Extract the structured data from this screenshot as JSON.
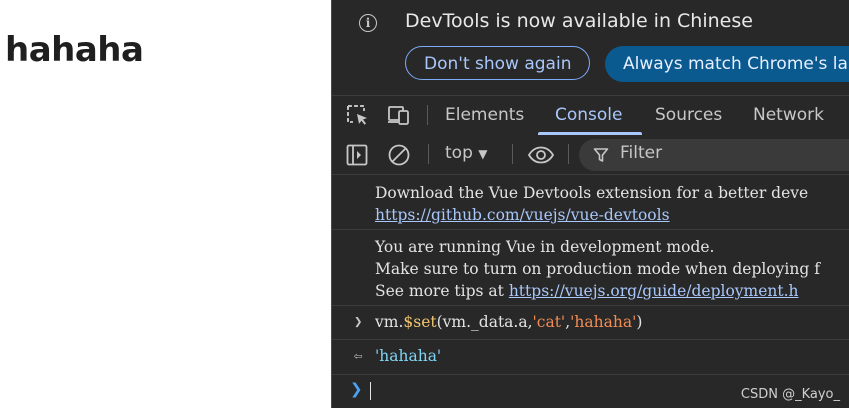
{
  "page": {
    "heading": "hahaha"
  },
  "devtools": {
    "infobar": {
      "message": "DevTools is now available in Chinese",
      "dont_show_label": "Don't show again",
      "always_match_label": "Always match Chrome's lar"
    },
    "tabs": [
      {
        "label": "Elements",
        "active": false
      },
      {
        "label": "Console",
        "active": true
      },
      {
        "label": "Sources",
        "active": false
      },
      {
        "label": "Network",
        "active": false
      }
    ],
    "console_toolbar": {
      "context": "top",
      "filter_placeholder": "Filter"
    },
    "messages": [
      {
        "lines": [
          {
            "text": "Download the Vue Devtools extension for a better deve",
            "link": ""
          },
          {
            "text": "",
            "link": "https://github.com/vuejs/vue-devtools"
          }
        ]
      },
      {
        "lines": [
          {
            "text": "You are running Vue in development mode.",
            "link": ""
          },
          {
            "text": "Make sure to turn on production mode when deploying f",
            "link": ""
          },
          {
            "text": "See more tips at ",
            "link": "https://vuejs.org/guide/deployment.h"
          }
        ]
      }
    ],
    "command": {
      "prefix": "vm.",
      "func": "$set",
      "args_plain": "(vm._data.a,",
      "arg1": "'cat'",
      "comma": ",",
      "arg2": "'hahaha'",
      "close": ")"
    },
    "result": "'hahaha'",
    "watermark": "CSDN @_Kayo_",
    "colors": {
      "accent": "#a8c7fa",
      "background": "#282828",
      "string": "#f28b54",
      "function": "#f1c56e",
      "return_value": "#7fd4f5"
    }
  }
}
